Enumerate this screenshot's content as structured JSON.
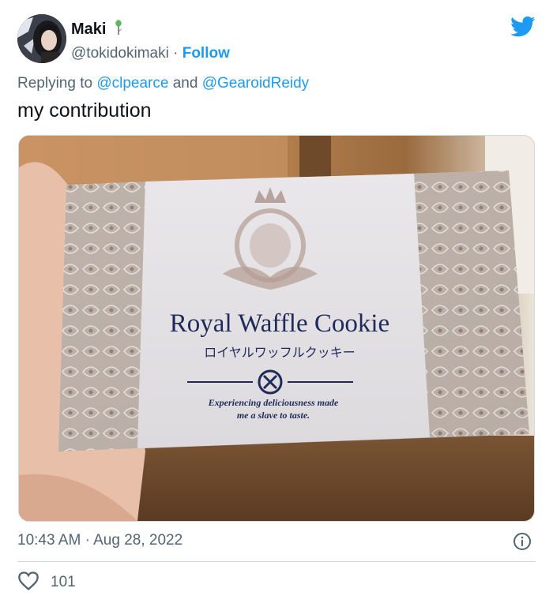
{
  "tweet": {
    "display_name": "Maki",
    "handle": "@tokidokimaki",
    "separator": "·",
    "follow_label": "Follow",
    "reply_prefix": "Replying to",
    "reply_mention_1": "@clpearce",
    "reply_and": "and",
    "reply_mention_2": "@GearoidReidy",
    "text": "my contribution",
    "time": "10:43 AM",
    "date_separator": "·",
    "date": "Aug 28, 2022",
    "like_count": "101"
  },
  "photo": {
    "package_title": "Royal Waffle Cookie",
    "package_subtitle_jp": "ロイヤルワッフルクッキー",
    "package_tagline_1": "Experiencing deliciousness made",
    "package_tagline_2": "me a slave to taste."
  },
  "colors": {
    "link_blue": "#1d9bf0",
    "secondary_text": "#536471",
    "package_navy": "#1f2a5a"
  },
  "icons": [
    "leaf-badge-icon",
    "twitter-bird-icon",
    "info-icon",
    "heart-icon"
  ]
}
